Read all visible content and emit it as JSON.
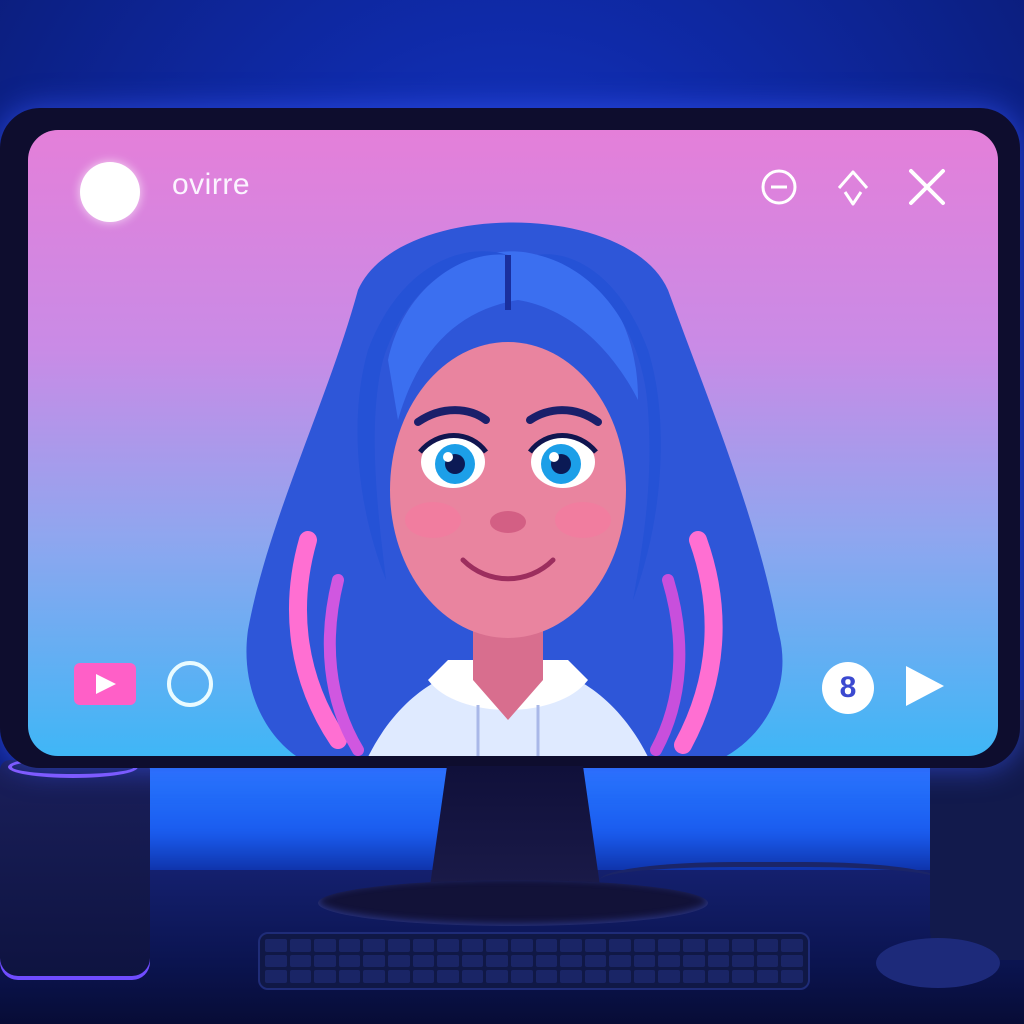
{
  "app": {
    "title": "ovirre"
  },
  "window_controls": {
    "minimize_icon": "minus-circle-icon",
    "up_icon": "up-arrow-icon",
    "close_icon": "close-icon"
  },
  "player_controls": {
    "video_icon": "video-play-badge-icon",
    "loading_icon": "loading-ring-icon",
    "counter_value": "8",
    "play_icon": "play-triangle-icon"
  },
  "colors": {
    "screen_top": "#e47fd9",
    "screen_bottom": "#3fb6f6",
    "accent_pink": "#ff5fc7",
    "room_blue": "#0f2aa8"
  }
}
